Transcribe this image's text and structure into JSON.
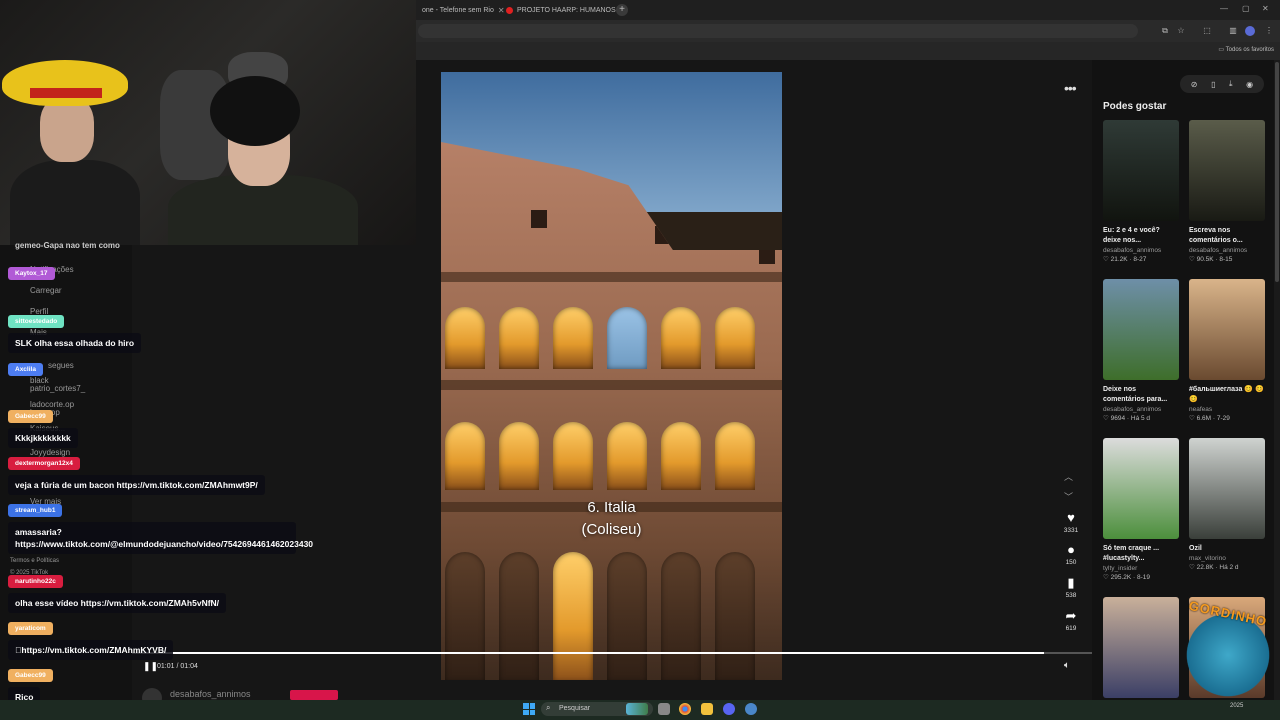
{
  "browser": {
    "tabs": [
      {
        "label": "one - Telefone sem Rio"
      },
      {
        "label": "PROJETO HAARP: HUMANOS"
      }
    ],
    "bookmarks_label": "Todos os favoritos"
  },
  "sidebar": {
    "items": [
      "Notificações",
      "Carregar",
      "Perfil",
      "Mais",
      "segues",
      "black",
      "patrio_cortes7_",
      "ladocorte.op",
      "lucas.op",
      "Kaiseus...",
      "Joyydesign",
      "Ver mais",
      "Termos e Políticas",
      "© 2025 TikTok"
    ]
  },
  "chat": [
    {
      "user": "gemeo-Gapa nao tem como",
      "user_color": "#555555",
      "message": ""
    },
    {
      "user": "Kaytox_17",
      "user_color": "#b15ad6",
      "message": ""
    },
    {
      "user": "sittoestedado",
      "user_color": "#6fe3c3",
      "message": "SLK olha essa olhada do hiro"
    },
    {
      "user": "Axclila",
      "user_color": "#4d7df2",
      "message": ""
    },
    {
      "user": "Gabecc99",
      "user_color": "#f0b060",
      "message": "Kkkjkkkkkkkk"
    },
    {
      "user": "dextermorgan12x4",
      "user_color": "#d81d3f",
      "message": "veja a fúria de um bacon https://vm.tiktok.com/ZMAhmwt9P/"
    },
    {
      "user": "stream_hub1",
      "user_color": "#3c72e6",
      "message": "amassaria? https://www.tiktok.com/@elmundodejuancho/video/7542694461462023430"
    },
    {
      "user": "narutinho22c",
      "user_color": "#d81d3f",
      "message": "olha esse vídeo https://vm.tiktok.com/ZMAh5vNfN/"
    },
    {
      "user": "yaraticom",
      "user_color": "#f0b060",
      "message": "\u0000https://vm.tiktok.com/ZMAhmKYVB/"
    },
    {
      "user": "Gabecc99",
      "user_color": "#f0b060",
      "message": "Rico"
    }
  ],
  "video": {
    "caption_line1": "6. Italia",
    "caption_line2": "(Coliseu)",
    "likes": "3331",
    "comments": "150",
    "saves": "538",
    "shares": "619",
    "time": "01:01 / 01:04",
    "progress": 0.95,
    "author": "desabafos_annimos"
  },
  "right_panel": {
    "title": "Podes gostar",
    "cards": [
      {
        "title": "Eu: 2 e 4 e você? deixe nos...",
        "author": "desabafos_annimos",
        "meta": "♡ 21.2K · 8-27",
        "colors": [
          "#2f3a36",
          "#11140f"
        ]
      },
      {
        "title": "Escreva nos comentários o...",
        "author": "desabafos_annimos",
        "meta": "♡ 90.5K · 8-15",
        "colors": [
          "#5a5c4a",
          "#191a14"
        ]
      },
      {
        "title": "Deixe nos comentários para...",
        "author": "desabafos_annimos",
        "meta": "♡ 9694 · Há 5 d",
        "colors": [
          "#6e8fa8",
          "#3e6e2a"
        ]
      },
      {
        "title": "#бальшиеглаза 😊 😊😊",
        "author": "neafeas",
        "meta": "♡ 6.6M · 7-29",
        "colors": [
          "#d9b48a",
          "#6a4a30"
        ]
      },
      {
        "title": "Só tem craque ... #lucastylty...",
        "author": "tylty_insider",
        "meta": "♡ 295.2K · 8-19",
        "colors": [
          "#dcdcdc",
          "#4c8f3c"
        ]
      },
      {
        "title": "Ozil",
        "author": "max_vitorino",
        "meta": "♡ 22.8K · Há 2 d",
        "colors": [
          "#cfd3d0",
          "#3a3f3a"
        ]
      },
      {
        "title": "",
        "author": "",
        "meta": "",
        "colors": [
          "#c9b09a",
          "#3b3f66"
        ]
      },
      {
        "title": "",
        "author": "",
        "meta": "",
        "colors": [
          "#d9a87a",
          "#5a3a2a"
        ]
      }
    ]
  },
  "taskbar": {
    "search_placeholder": "Pesquisar",
    "clock_date": "2025"
  },
  "logo_text": "GORDINHO"
}
